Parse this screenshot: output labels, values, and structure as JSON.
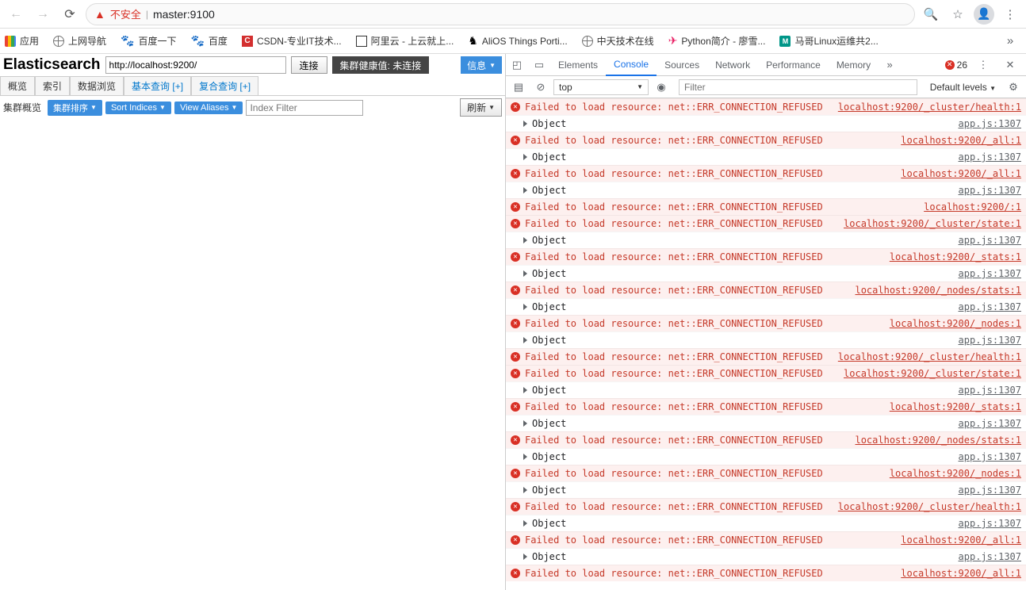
{
  "browser": {
    "insecure_label": "不安全",
    "url": "master:9100"
  },
  "bookmarks": {
    "apps": "应用",
    "items": [
      "上网导航",
      "百度一下",
      "百度",
      "CSDN-专业IT技术...",
      "阿里云 - 上云就上...",
      "AliOS Things Porti...",
      "中天技术在线",
      "Python简介 - 廖雪...",
      "马哥Linux运维共2..."
    ]
  },
  "es": {
    "title": "Elasticsearch",
    "url_value": "http://localhost:9200/",
    "connect": "连接",
    "health": "集群健康值: 未连接",
    "info": "信息",
    "tabs": [
      "概览",
      "索引",
      "数据浏览",
      "基本查询 [+]",
      "复合查询 [+]"
    ],
    "sub_label": "集群概览",
    "pill_sort_cn": "集群排序",
    "pill_sort_en": "Sort Indices",
    "pill_view": "View Aliases",
    "filter_ph": "Index Filter",
    "refresh": "刷新"
  },
  "devtools": {
    "tabs": [
      "Elements",
      "Console",
      "Sources",
      "Network",
      "Performance",
      "Memory"
    ],
    "error_count": "26",
    "context": "top",
    "filter_ph": "Filter",
    "levels": "Default levels",
    "err_msg": "Failed to load resource: net::ERR_CONNECTION_REFUSED",
    "obj_msg": "Object",
    "app_src": "app.js:1307",
    "logs": [
      {
        "t": "err",
        "src": "localhost:9200/_cluster/health:1"
      },
      {
        "t": "obj"
      },
      {
        "t": "err",
        "src": "localhost:9200/_all:1"
      },
      {
        "t": "obj"
      },
      {
        "t": "err",
        "src": "localhost:9200/_all:1"
      },
      {
        "t": "obj"
      },
      {
        "t": "err",
        "src": "localhost:9200/:1"
      },
      {
        "t": "err",
        "src": "localhost:9200/_cluster/state:1"
      },
      {
        "t": "obj"
      },
      {
        "t": "err",
        "src": "localhost:9200/_stats:1"
      },
      {
        "t": "obj"
      },
      {
        "t": "err",
        "src": "localhost:9200/_nodes/stats:1"
      },
      {
        "t": "obj"
      },
      {
        "t": "err",
        "src": "localhost:9200/_nodes:1"
      },
      {
        "t": "obj"
      },
      {
        "t": "err",
        "src": "localhost:9200/_cluster/health:1"
      },
      {
        "t": "err",
        "src": "localhost:9200/_cluster/state:1"
      },
      {
        "t": "obj"
      },
      {
        "t": "err",
        "src": "localhost:9200/_stats:1"
      },
      {
        "t": "obj"
      },
      {
        "t": "err",
        "src": "localhost:9200/_nodes/stats:1"
      },
      {
        "t": "obj"
      },
      {
        "t": "err",
        "src": "localhost:9200/_nodes:1"
      },
      {
        "t": "obj"
      },
      {
        "t": "err",
        "src": "localhost:9200/_cluster/health:1"
      },
      {
        "t": "obj"
      },
      {
        "t": "err",
        "src": "localhost:9200/_all:1"
      },
      {
        "t": "obj"
      },
      {
        "t": "err",
        "src": "localhost:9200/_all:1"
      }
    ]
  }
}
